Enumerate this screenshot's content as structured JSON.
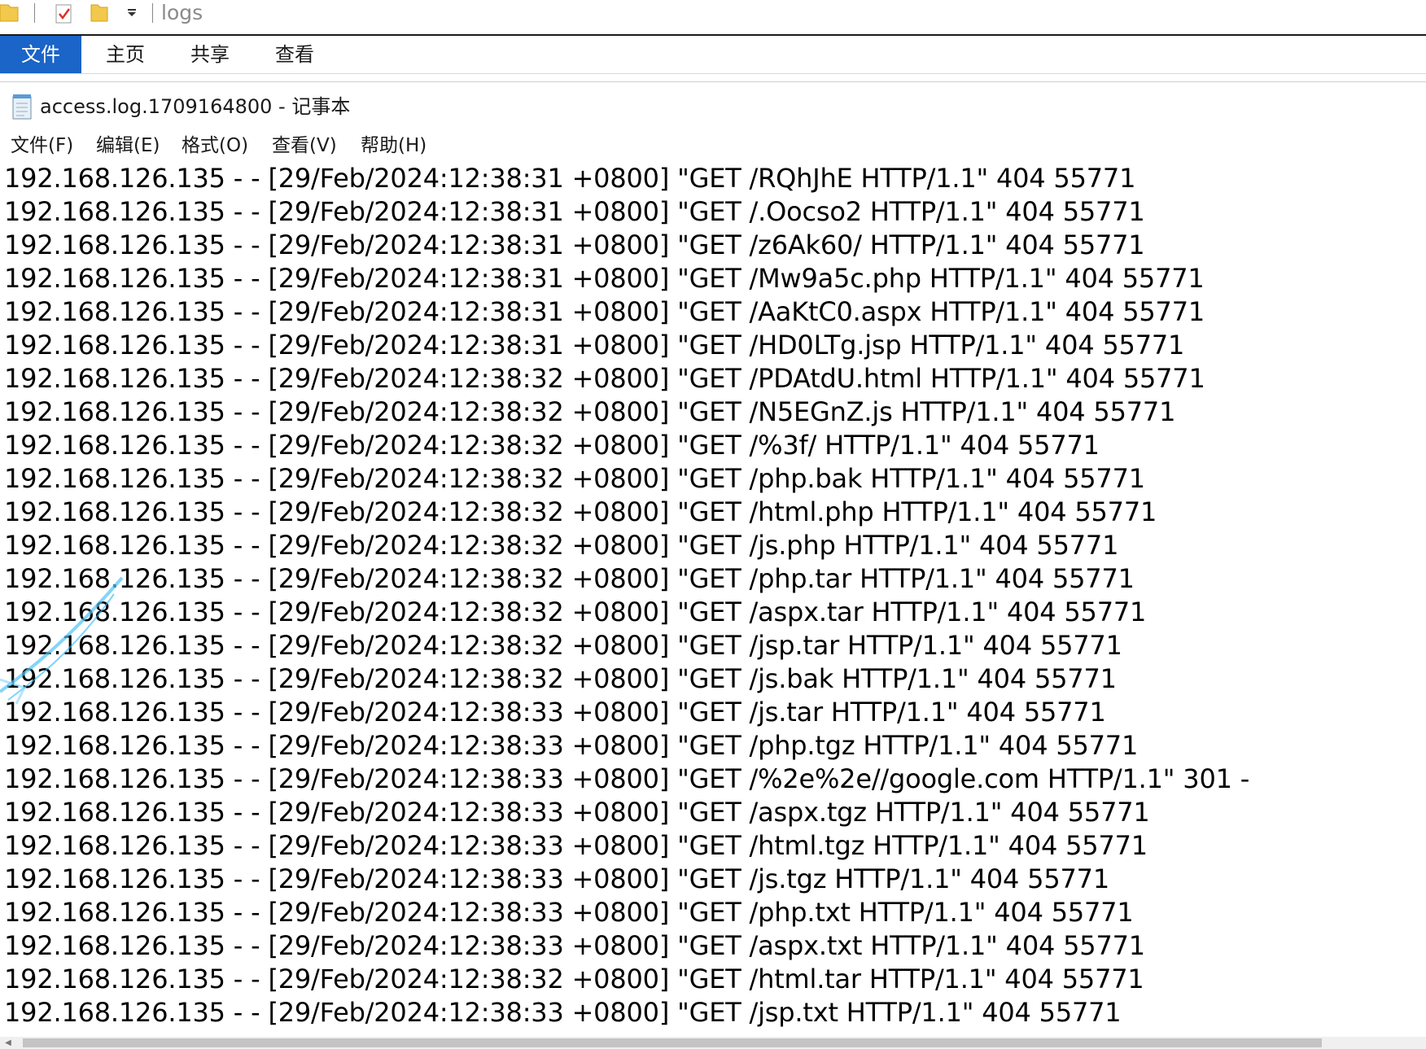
{
  "explorer": {
    "title": "logs",
    "quick_access": {
      "icons": [
        "folder-icon",
        "properties-icon",
        "new-folder-icon",
        "dropdown-icon"
      ]
    },
    "ribbon_tabs": [
      "文件",
      "主页",
      "共享",
      "查看"
    ],
    "active_tab_color": "#1b64c8"
  },
  "notepad": {
    "window_title": "access.log.1709164800 - 记事本",
    "menu": [
      "文件(F)",
      "编辑(E)",
      "格式(O)",
      "查看(V)",
      "帮助(H)"
    ],
    "lines": [
      "192.168.126.135 - - [29/Feb/2024:12:38:31 +0800] \"GET /RQhJhE HTTP/1.1\" 404 55771",
      "192.168.126.135 - - [29/Feb/2024:12:38:31 +0800] \"GET /.Oocso2 HTTP/1.1\" 404 55771",
      "192.168.126.135 - - [29/Feb/2024:12:38:31 +0800] \"GET /z6Ak60/ HTTP/1.1\" 404 55771",
      "192.168.126.135 - - [29/Feb/2024:12:38:31 +0800] \"GET /Mw9a5c.php HTTP/1.1\" 404 55771",
      "192.168.126.135 - - [29/Feb/2024:12:38:31 +0800] \"GET /AaKtC0.aspx HTTP/1.1\" 404 55771",
      "192.168.126.135 - - [29/Feb/2024:12:38:31 +0800] \"GET /HD0LTg.jsp HTTP/1.1\" 404 55771",
      "192.168.126.135 - - [29/Feb/2024:12:38:32 +0800] \"GET /PDAtdU.html HTTP/1.1\" 404 55771",
      "192.168.126.135 - - [29/Feb/2024:12:38:32 +0800] \"GET /N5EGnZ.js HTTP/1.1\" 404 55771",
      "192.168.126.135 - - [29/Feb/2024:12:38:32 +0800] \"GET /%3f/ HTTP/1.1\" 404 55771",
      "192.168.126.135 - - [29/Feb/2024:12:38:32 +0800] \"GET /php.bak HTTP/1.1\" 404 55771",
      "192.168.126.135 - - [29/Feb/2024:12:38:32 +0800] \"GET /html.php HTTP/1.1\" 404 55771",
      "192.168.126.135 - - [29/Feb/2024:12:38:32 +0800] \"GET /js.php HTTP/1.1\" 404 55771",
      "192.168.126.135 - - [29/Feb/2024:12:38:32 +0800] \"GET /php.tar HTTP/1.1\" 404 55771",
      "192.168.126.135 - - [29/Feb/2024:12:38:32 +0800] \"GET /aspx.tar HTTP/1.1\" 404 55771",
      "192.168.126.135 - - [29/Feb/2024:12:38:32 +0800] \"GET /jsp.tar HTTP/1.1\" 404 55771",
      "192.168.126.135 - - [29/Feb/2024:12:38:32 +0800] \"GET /js.bak HTTP/1.1\" 404 55771",
      "192.168.126.135 - - [29/Feb/2024:12:38:33 +0800] \"GET /js.tar HTTP/1.1\" 404 55771",
      "192.168.126.135 - - [29/Feb/2024:12:38:33 +0800] \"GET /php.tgz HTTP/1.1\" 404 55771",
      "192.168.126.135 - - [29/Feb/2024:12:38:33 +0800] \"GET /%2e%2e//google.com HTTP/1.1\" 301 -",
      "192.168.126.135 - - [29/Feb/2024:12:38:33 +0800] \"GET /aspx.tgz HTTP/1.1\" 404 55771",
      "192.168.126.135 - - [29/Feb/2024:12:38:33 +0800] \"GET /html.tgz HTTP/1.1\" 404 55771",
      "192.168.126.135 - - [29/Feb/2024:12:38:33 +0800] \"GET /js.tgz HTTP/1.1\" 404 55771",
      "192.168.126.135 - - [29/Feb/2024:12:38:33 +0800] \"GET /php.txt HTTP/1.1\" 404 55771",
      "192.168.126.135 - - [29/Feb/2024:12:38:33 +0800] \"GET /aspx.txt HTTP/1.1\" 404 55771",
      "192.168.126.135 - - [29/Feb/2024:12:38:32 +0800] \"GET /html.tar HTTP/1.1\" 404 55771",
      "192.168.126.135 - - [29/Feb/2024:12:38:33 +0800] \"GET /jsp.txt HTTP/1.1\" 404 55771"
    ]
  }
}
